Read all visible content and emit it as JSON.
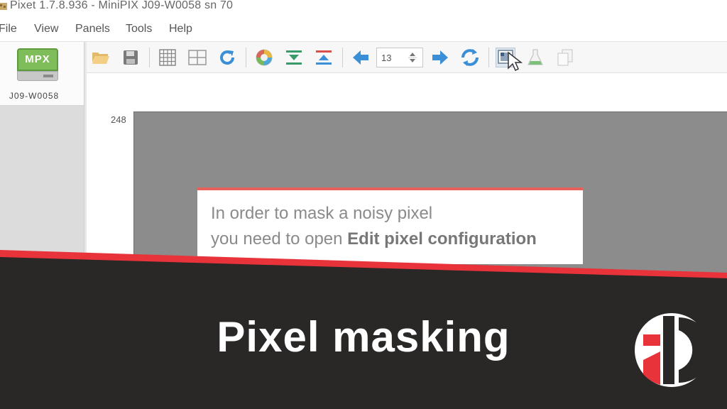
{
  "window": {
    "title": "Pixet 1.7.8.936 - MiniPIX J09-W0058 sn 70"
  },
  "menu": {
    "items": [
      "File",
      "View",
      "Panels",
      "Tools",
      "Help"
    ]
  },
  "device_panel": {
    "drive_label": "MPX",
    "device_name": "J09-W0058"
  },
  "toolbar": {
    "icons": [
      "open-folder-icon",
      "save-icon",
      "grid-icon",
      "table-icon",
      "refresh-icon",
      "color-palette-icon",
      "bottom-align-icon",
      "top-align-icon",
      "arrow-left-icon",
      "arrow-right-icon",
      "sync-icon",
      "edit-pixel-configuration-icon",
      "flask-icon",
      "copy-icon"
    ],
    "frame_counter": "13"
  },
  "canvas": {
    "y_axis_top_label": "248"
  },
  "callout": {
    "line1": "In order to mask a noisy pixel",
    "line2_prefix": "you need to open ",
    "line2_bold": "Edit pixel configuration"
  },
  "banner": {
    "title": "Pixel masking"
  },
  "colors": {
    "banner_bg": "#2a2727",
    "accent_red": "#e8333a",
    "drive_green": "#7fbd5a",
    "arrow_blue": "#3b8fd6"
  }
}
